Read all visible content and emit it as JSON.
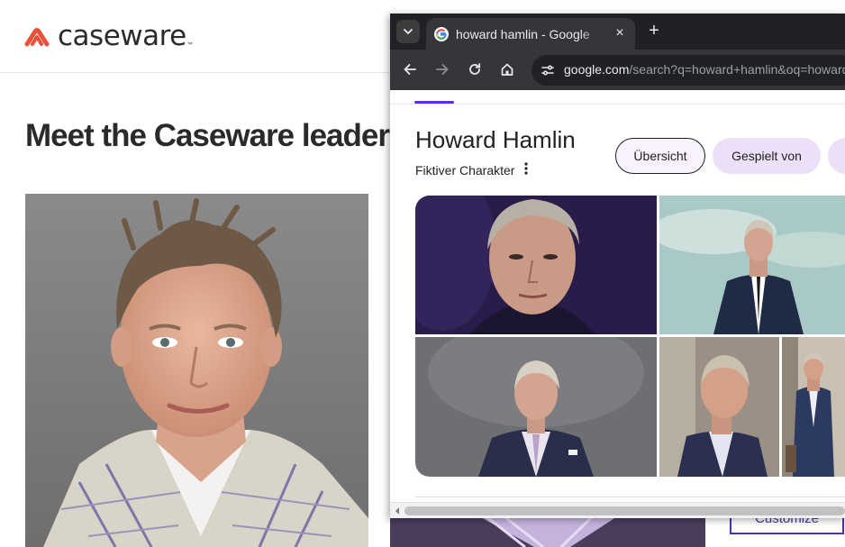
{
  "background_page": {
    "logo_text": "caseware",
    "logo_tm": "™",
    "heading": "Meet the Caseware leader",
    "customize_label": "Customize",
    "brand_color": "#e8523b",
    "accent_color": "#4b2fb8"
  },
  "browser": {
    "tab": {
      "title": "howard hamlin - Google",
      "favicon": "google-g-icon",
      "close_icon": "×"
    },
    "new_tab_icon": "+",
    "toolbar": {
      "back_icon": "back-arrow-icon",
      "forward_icon": "forward-arrow-icon",
      "reload_icon": "reload-icon",
      "home_icon": "home-icon",
      "site_info_icon": "tune-icon"
    },
    "omnibox": {
      "host": "google.com",
      "path": "/search?q=howard+hamlin&oq=howard+hamlin"
    }
  },
  "knowledge_panel": {
    "title": "Howard Hamlin",
    "subtitle": "Fiktiver Charakter",
    "chips": [
      {
        "label": "Übersicht",
        "selected": true
      },
      {
        "label": "Gespielt von",
        "selected": false
      },
      {
        "label": "",
        "selected": false
      }
    ],
    "images": [
      {
        "name": "portrait-closeup-purple"
      },
      {
        "name": "standing-suit-sky"
      },
      {
        "name": "studio-suit-grey"
      },
      {
        "name": "profile-office"
      },
      {
        "name": "full-body-suit"
      }
    ]
  }
}
